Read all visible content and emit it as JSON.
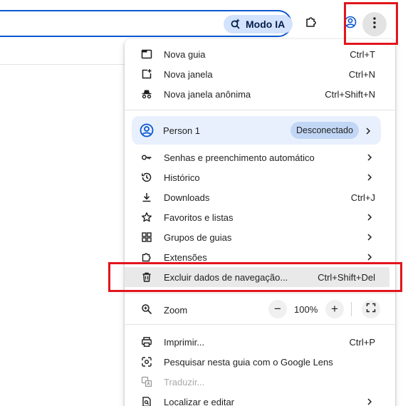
{
  "toolbar": {
    "ai_mode_label": "Modo IA",
    "ai_mode_icon": "search-spark-icon",
    "extensions_icon": "puzzle-icon",
    "profile_icon": "profile-icon",
    "menu_icon": "more-vert-icon"
  },
  "menu": {
    "items_top": [
      {
        "label": "Nova guia",
        "shortcut": "Ctrl+T",
        "icon": "new-tab-icon"
      },
      {
        "label": "Nova janela",
        "shortcut": "Ctrl+N",
        "icon": "new-window-icon"
      },
      {
        "label": "Nova janela anônima",
        "shortcut": "Ctrl+Shift+N",
        "icon": "incognito-icon"
      }
    ],
    "profile": {
      "name": "Person 1",
      "status": "Desconectado",
      "icon": "account-circle-icon"
    },
    "items_middle": [
      {
        "label": "Senhas e preenchimento automático",
        "icon": "key-icon"
      },
      {
        "label": "Histórico",
        "icon": "history-icon"
      },
      {
        "label": "Downloads",
        "shortcut": "Ctrl+J",
        "icon": "download-icon"
      },
      {
        "label": "Favoritos e listas",
        "icon": "star-icon"
      },
      {
        "label": "Grupos de guias",
        "icon": "tab-groups-icon"
      },
      {
        "label": "Extensões",
        "icon": "puzzle-icon"
      },
      {
        "label": "Excluir dados de navegação...",
        "shortcut": "Ctrl+Shift+Del",
        "icon": "trash-icon"
      }
    ],
    "zoom": {
      "label": "Zoom",
      "value": "100%",
      "minus": "−",
      "plus": "+",
      "icon": "zoom-icon",
      "fullscreen_icon": "fullscreen-icon"
    },
    "items_bottom": [
      {
        "label": "Imprimir...",
        "shortcut": "Ctrl+P",
        "icon": "print-icon"
      },
      {
        "label": "Pesquisar nesta guia com o Google Lens",
        "icon": "google-lens-icon"
      },
      {
        "label": "Traduzir...",
        "icon": "translate-icon"
      },
      {
        "label": "Localizar e editar",
        "icon": "find-icon"
      }
    ]
  },
  "colors": {
    "accent": "#0b57d0",
    "ai_chip_bg": "#d3e3fd",
    "highlight_red": "#e2151c",
    "profile_row_bg": "#e8f0fe"
  }
}
